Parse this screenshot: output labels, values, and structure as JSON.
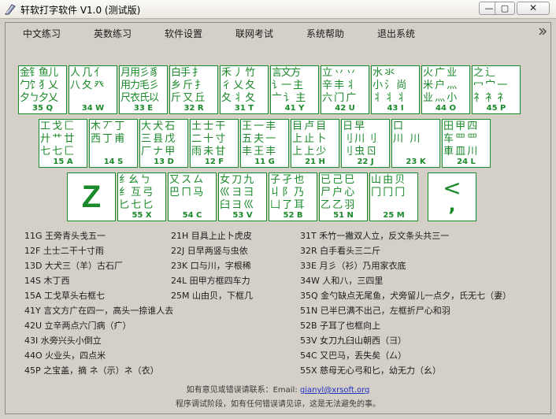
{
  "window": {
    "title": "轩软打字软件 V1.0 (测试版)"
  },
  "menu": [
    "中文练习",
    "英数练习",
    "软件设置",
    "联网考试",
    "系统帮助",
    "退出系统"
  ],
  "keys_row1": [
    {
      "glyphs": "金钅鱼儿\n勹饣犭乂\n夕ㄅ夕乂",
      "code": "35 Q"
    },
    {
      "glyphs": "人 几 亻\n八 夂 癶",
      "code": "34 W"
    },
    {
      "glyphs": "月用彡豸\n用力毛彡\n尺衣氏以",
      "code": "33 E"
    },
    {
      "glyphs": "白手 扌\n乡 斤 扌\n斤 又 丘",
      "code": "32 R"
    },
    {
      "glyphs": "禾 丿 竹\n彳 乂 夂\n夂 丬 夂",
      "code": "31 T"
    },
    {
      "glyphs": "言文方\n讠一 主\n亠 讠 主",
      "code": "41 Y"
    },
    {
      "glyphs": "立 丷 丷\n辛 丰 丬\n六 门 广",
      "code": "42 U"
    },
    {
      "glyphs": "水 氺 \n小 氵 尚\n丬 丬 丬",
      "code": "43 I"
    },
    {
      "glyphs": "火 广 业\n米 户 灬\n业 灬 小",
      "code": "44 O"
    },
    {
      "glyphs": "之 辶 \n冖 宀 一\n礻 衤 礻",
      "code": "45 P"
    }
  ],
  "keys_row2": [
    {
      "glyphs": "工 戈 匚\n廾 艹 廿\n七 七 匚",
      "code": "15 A"
    },
    {
      "glyphs": "木 丆 丁\n西 丁 甫",
      "code": "14 S"
    },
    {
      "glyphs": "大 犬 石\n三 县 戊\n厂 ナ 甲",
      "code": "13 D"
    },
    {
      "glyphs": "土 士 干\n二 十 寸\n雨 未 甘",
      "code": "12 F"
    },
    {
      "glyphs": "王 一 丰\n五 夫 一\n丰 王 丰",
      "code": "11 G"
    },
    {
      "glyphs": "目 卢 目\n上 止 卜\n上 上 少",
      "code": "21 H"
    },
    {
      "glyphs": "日 早\n刂 川 刂\n刂 虫 ㄖ",
      "code": "22 J"
    },
    {
      "glyphs": "口\n川   川",
      "code": "23 K"
    },
    {
      "glyphs": "田 甲 四\n车 罒 罒\n車 皿 川",
      "code": "24 L"
    }
  ],
  "keys_row3": [
    {
      "glyphs": "Z",
      "code": ""
    },
    {
      "glyphs": "纟幺 ㄅ\n纟 互 弓\n匕 七 匕",
      "code": "55 X"
    },
    {
      "glyphs": "又 ス ㄙ\n巴 ㄇ 马",
      "code": "54 C"
    },
    {
      "glyphs": "女 刀 九\n巛 ヨ 彐\n臼 ヨ 巛",
      "code": "53 V"
    },
    {
      "glyphs": "子 孑 也\n丩 阝 乃\n凵 了 耳",
      "code": "52 B"
    },
    {
      "glyphs": "已 己 巳\n尸 户 心\n乙 乙 羽",
      "code": "51 N"
    },
    {
      "glyphs": "山 由 贝\n冂 冂 冂",
      "code": "25 M"
    },
    {
      "glyphs": "<",
      "code": ","
    }
  ],
  "mnemonics": {
    "col1": [
      "11G 王旁青头戋五一",
      "12F 土士二干十寸雨",
      "13D 大犬三（羊）古石厂",
      "14S 木丁西",
      "15A 工戈草头右框七",
      "41Y 言文方广在四一，高头一捺谁人去",
      "42U 立辛两点六门病（疒）",
      "43I 水旁兴头小倒立",
      "44O 火业头，四点米",
      "45P 之宝盖，摘 ネ（示）ネ（衣）"
    ],
    "col2": [
      "21H 目具上止卜虎皮",
      "22J 日早两竖与虫依",
      "23K 口与川，字根稀",
      "24L 田甲方框四车力",
      "25M 山由贝，下框几"
    ],
    "col3": [
      "31T 禾竹一撇双人立，反文条头共三一",
      "32R 白手看头三二斤",
      "33E 月彡（衫）乃用家衣底",
      "34W 人和八，三四里",
      "35Q 金勺缺点无尾鱼，犬旁留儿一点夕，氏无七（妻）",
      "51N 已半巳满不出己，左框折尸心和羽",
      "52B 子耳了也框向上",
      "53V 女刀九臼山朝西（彐）",
      "54C 又巴马，丢失矣（厶）",
      "55X 慈母无心弓和匕，幼无力（幺）"
    ]
  },
  "footer": {
    "contact_label": "如有意见或错误请联系：Email:",
    "email": "gianyl@xrsoft.org",
    "notice": "程序调试阶段，如有任何错误请见谅，这是无法避免的事。"
  },
  "colors": {
    "key_green": "#1a8a2a",
    "background": "#d4d0c8"
  }
}
